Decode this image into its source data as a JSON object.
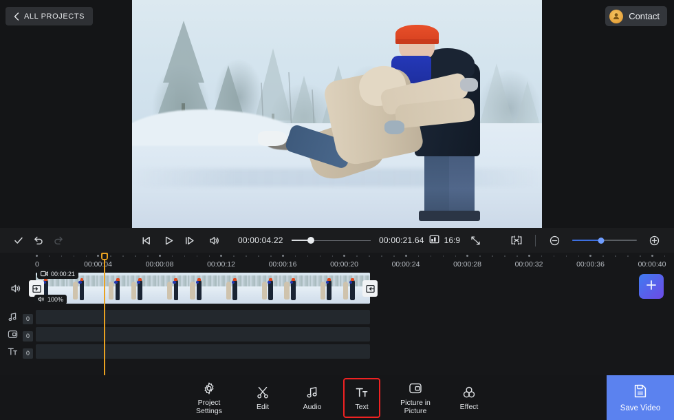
{
  "header": {
    "all_projects_label": "ALL PROJECTS",
    "contact_label": "Contact"
  },
  "controls": {
    "check_icon": "check-icon",
    "undo_icon": "undo-icon",
    "redo_icon": "redo-icon",
    "skip_back_icon": "skip-back-icon",
    "play_icon": "play-icon",
    "skip_forward_icon": "skip-forward-icon",
    "volume_icon": "volume-icon",
    "current_time": "00:00:04.22",
    "total_time": "00:00:21.64",
    "scrub_percent": 25,
    "aspect_ratio": "16:9",
    "aspect_icon": "aspect-ratio-icon",
    "fullscreen_icon": "fullscreen-icon",
    "fit_icon": "fit-to-screen-icon",
    "zoom_out_label": "−",
    "zoom_in_label": "+",
    "zoom_percent": 45
  },
  "timeline": {
    "ruler_labels": [
      "0",
      "00:00:04",
      "00:00:08",
      "00:00:12",
      "00:00:16",
      "00:00:20",
      "00:00:24",
      "00:00:28",
      "00:00:32",
      "00:00:36",
      "00:00:40"
    ],
    "playhead_time": "00:00:04.22",
    "clip": {
      "duration_badge": "00:00:21",
      "duration_icon": "video-clip-icon",
      "volume_badge": "100%",
      "volume_icon": "volume-small-icon",
      "trim_left_icon": "trim-left-handle-icon",
      "trim_right_icon": "trim-right-handle-icon",
      "track_mute_icon": "track-volume-icon"
    },
    "tracks": [
      {
        "name": "audio",
        "icon": "music-note-icon",
        "count": "0"
      },
      {
        "name": "picture-in-picture",
        "icon": "pip-icon",
        "count": "0"
      },
      {
        "name": "text",
        "icon": "text-tt-icon",
        "count": "0"
      }
    ],
    "add_button_icon": "plus-icon"
  },
  "bottom_tools": [
    {
      "label": "Project\nSettings",
      "icon": "gear-icon",
      "selected": false,
      "name": "project-settings"
    },
    {
      "label": "Edit",
      "icon": "scissors-icon",
      "selected": false,
      "name": "edit"
    },
    {
      "label": "Audio",
      "icon": "music-note-icon",
      "selected": false,
      "name": "audio"
    },
    {
      "label": "Text",
      "icon": "text-tt-icon",
      "selected": true,
      "name": "text"
    },
    {
      "label": "Picture in\nPicture",
      "icon": "pip-icon",
      "selected": false,
      "name": "picture-in-picture"
    },
    {
      "label": "Effect",
      "icon": "effect-icon",
      "selected": false,
      "name": "effect"
    }
  ],
  "save": {
    "label": "Save Video",
    "icon": "save-disk-icon"
  },
  "colors": {
    "accent_blue": "#5b82ef",
    "playhead_orange": "#e9a221",
    "selection_red": "#ef2222",
    "panel_dark": "#161719"
  }
}
